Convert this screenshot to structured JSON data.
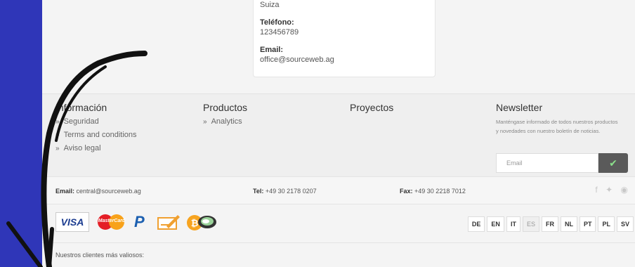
{
  "contact": {
    "country": "Suiza",
    "phone_label": "Teléfono:",
    "phone": "123456789",
    "email_label": "Email:",
    "email": "office@sourceweb.ag"
  },
  "footer": {
    "info": {
      "title": "Información",
      "items": [
        "Seguridad",
        "Terms and conditions",
        "Aviso legal"
      ]
    },
    "products": {
      "title": "Productos",
      "items": [
        "Analytics"
      ]
    },
    "projects": {
      "title": "Proyectos"
    },
    "newsletter": {
      "title": "Newsletter",
      "text": "Manténgase informado de todos nuestros productos y novedades con nuestro boletín de noticias.",
      "placeholder": "Email"
    }
  },
  "contact_bar": {
    "email_label": "Email:",
    "email": "central@sourceweb.ag",
    "tel_label": "Tel:",
    "tel": "+49 30 2178 0207",
    "fax_label": "Fax:",
    "fax": "+49 30 2218 7012",
    "socials": [
      "facebook-icon",
      "twitter-icon",
      "settings-icon"
    ]
  },
  "payments": {
    "visa": "VISA",
    "mastercard": "MasterCard",
    "paypal": "P"
  },
  "languages": [
    "DE",
    "EN",
    "IT",
    "ES",
    "FR",
    "NL",
    "PT",
    "PL",
    "SV"
  ],
  "active_language": "ES",
  "clients_label": "Nuestros clientes más valiosos:",
  "colors": {
    "band": "#2f36b8",
    "newsletter_button": "#5a5a5a",
    "check": "#8be08b"
  }
}
